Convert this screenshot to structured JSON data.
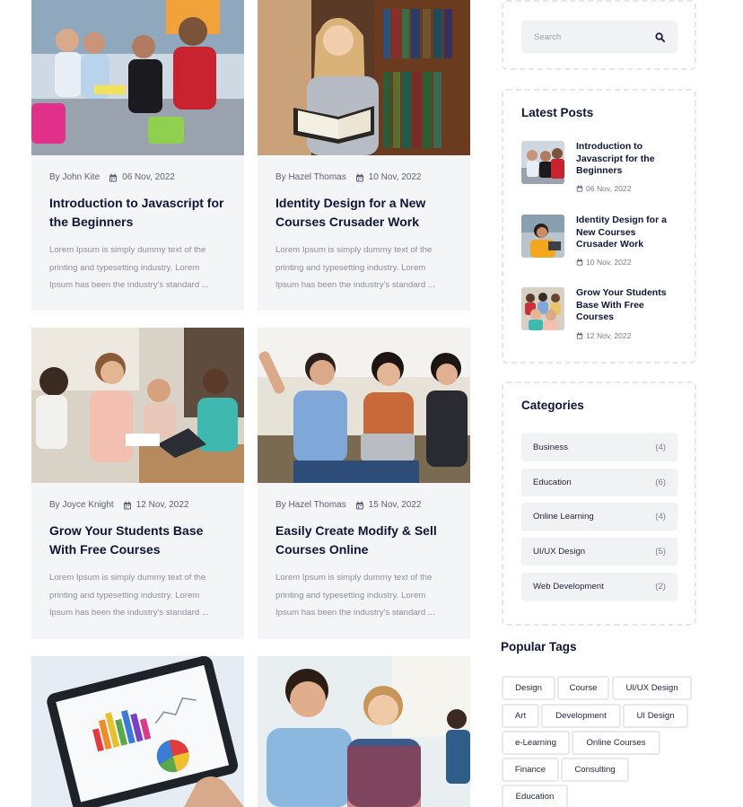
{
  "posts": [
    {
      "author": "By John Kite",
      "date": "06 Nov, 2022",
      "title": "Introduction to Javascript for the Beginners",
      "excerpt": "Lorem Ipsum is simply dummy text of the printing and typesetting industry. Lorem Ipsum has been the industry's standard ..."
    },
    {
      "author": "By Hazel Thomas",
      "date": "10 Nov, 2022",
      "title": "Identity Design for a New Courses Crusader Work",
      "excerpt": "Lorem Ipsum is simply dummy text of the printing and typesetting industry. Lorem Ipsum has been the industry's standard ..."
    },
    {
      "author": "By Joyce Knight",
      "date": "12 Nov, 2022",
      "title": "Grow Your Students Base With Free Courses",
      "excerpt": "Lorem Ipsum is simply dummy text of the printing and typesetting industry. Lorem Ipsum has been the industry's standard ..."
    },
    {
      "author": "By Hazel Thomas",
      "date": "15 Nov, 2022",
      "title": "Easily Create Modify & Sell Courses Online",
      "excerpt": "Lorem Ipsum is simply dummy text of the printing and typesetting industry. Lorem Ipsum has been the industry's standard ..."
    }
  ],
  "search": {
    "placeholder": "Search",
    "icon": "search-icon"
  },
  "latest": {
    "title": "Latest Posts",
    "items": [
      {
        "title": "Introduction to Javascript for the Beginners",
        "date": "06 Nov, 2022"
      },
      {
        "title": "Identity Design for a New Courses Crusader Work",
        "date": "10 Nov, 2022"
      },
      {
        "title": "Grow Your Students Base With Free Courses",
        "date": "12 Nov, 2022"
      }
    ]
  },
  "categories": {
    "title": "Categories",
    "items": [
      {
        "label": "Business",
        "count": "(4)"
      },
      {
        "label": "Education",
        "count": "(6)"
      },
      {
        "label": "Online Learning",
        "count": "(4)"
      },
      {
        "label": "UI/UX Design",
        "count": "(5)"
      },
      {
        "label": "Web Development",
        "count": "(2)"
      }
    ]
  },
  "tags": {
    "title": "Popular Tags",
    "items": [
      "Design",
      "Course",
      "UI/UX Design",
      "Art",
      "Development",
      "UI Design",
      "e-Learning",
      "Online Courses",
      "Finance",
      "Consulting",
      "Education"
    ]
  },
  "colors": {
    "heading": "#0f1535",
    "card_bg": "#f4f5f7",
    "muted": "#8a8fa0",
    "border": "#e6e7eb"
  }
}
